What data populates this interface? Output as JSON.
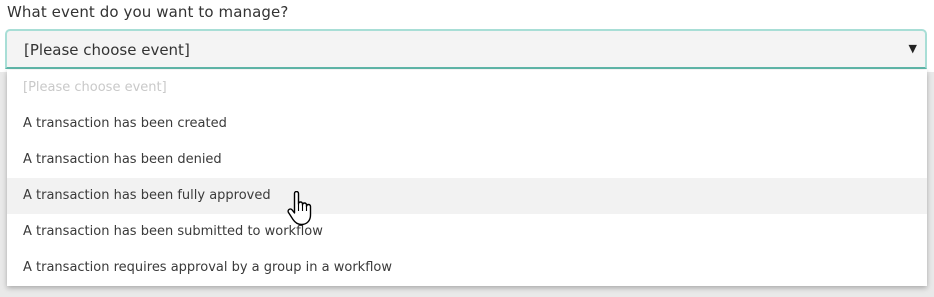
{
  "question": {
    "label": "What event do you want to manage?"
  },
  "select": {
    "selected_label": "[Please choose event]",
    "arrow_glyph": "▼",
    "border_color": "#a8ded6",
    "focus_color": "#5fb7a9"
  },
  "dropdown": {
    "options": [
      {
        "label": "[Please choose event]",
        "disabled": true
      },
      {
        "label": "A transaction has been created"
      },
      {
        "label": "A transaction has been denied"
      },
      {
        "label": "A transaction has been fully approved",
        "hovered": true
      },
      {
        "label": "A transaction has been submitted to workflow"
      },
      {
        "label": "A transaction requires approval by a group in a workflow"
      }
    ]
  },
  "cursor": {
    "icon": "hand-pointer-icon"
  }
}
